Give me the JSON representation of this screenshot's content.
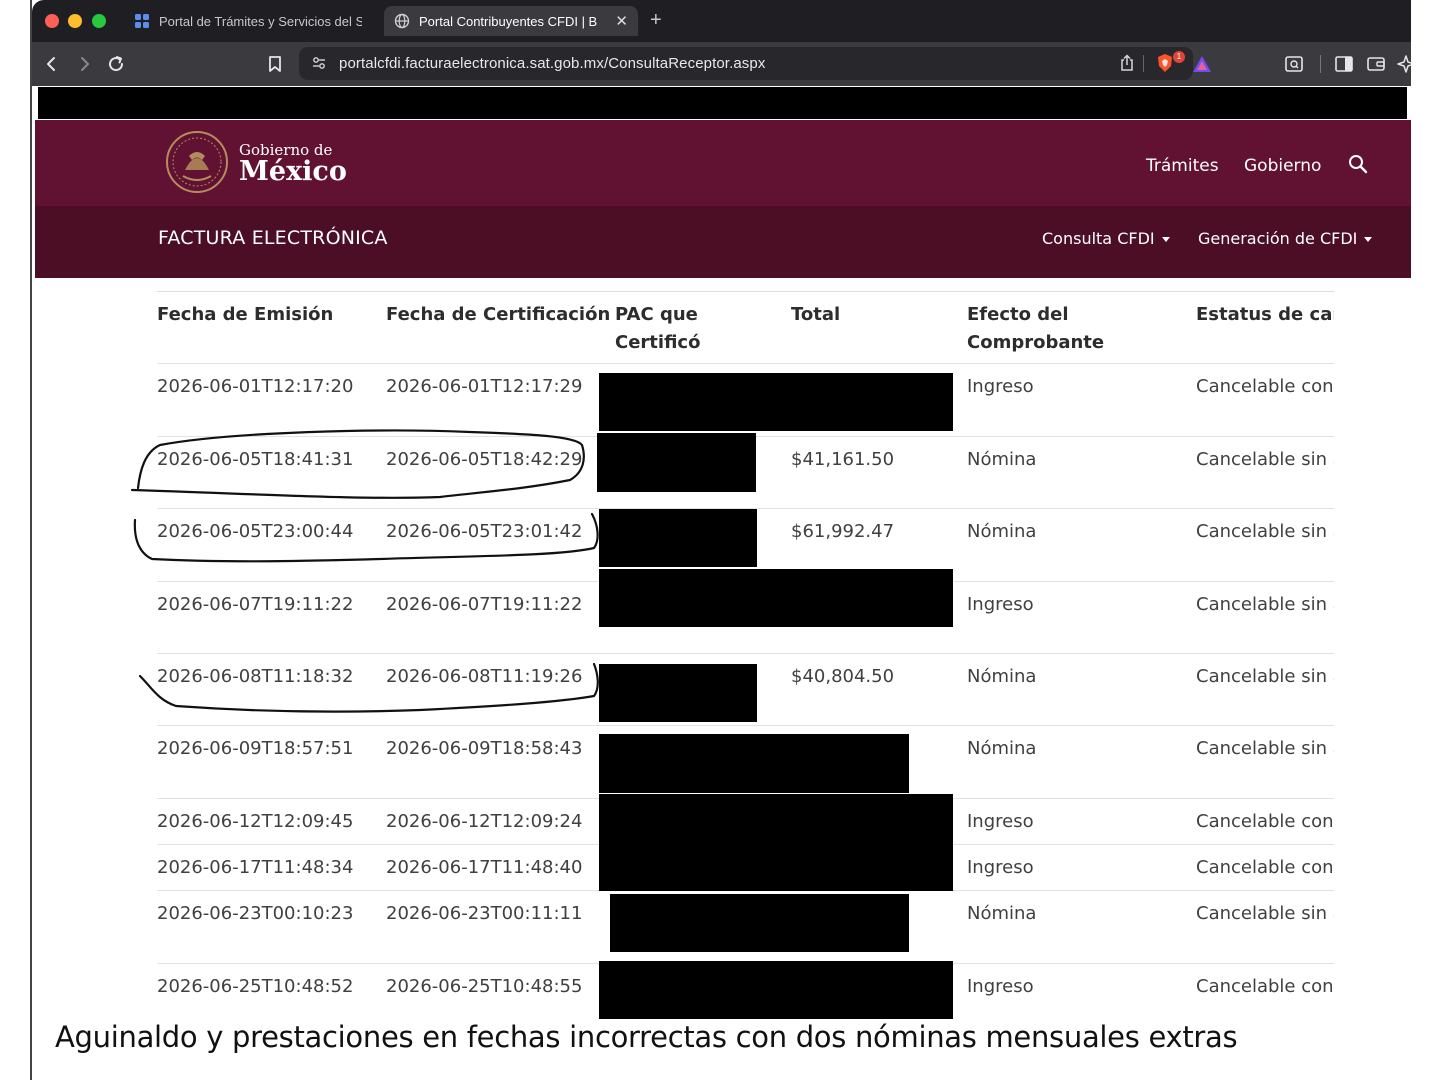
{
  "browser": {
    "tabs": [
      {
        "title": "Portal de Trámites y Servicios del S",
        "favicon": "grid-icon"
      },
      {
        "title": "Portal Contribuyentes CFDI | B",
        "favicon": "globe-icon",
        "active": true
      }
    ],
    "new_tab_label": "+",
    "close_tab_label": "✕",
    "url": "portalcfdi.facturaelectronica.sat.gob.mx/ConsultaReceptor.aspx",
    "notification_badge": "1"
  },
  "gob_header": {
    "logo_line1": "Gobierno de",
    "logo_line2": "México",
    "nav": {
      "tramites": "Trámites",
      "gobierno": "Gobierno"
    }
  },
  "sub_header": {
    "brand": "FACTURA ELECTRÓNICA",
    "menu": {
      "consulta": "Consulta CFDI",
      "generacion": "Generación de CFDI"
    }
  },
  "table": {
    "headers": {
      "fecha_emision": "Fecha de Emisión",
      "fecha_certificacion": "Fecha de Certificación",
      "pac_line1": "PAC que",
      "pac_line2": "Certificó",
      "total": "Total",
      "efecto_line1": "Efecto del",
      "efecto_line2": "Comprobante",
      "estatus": "Estatus de can"
    },
    "rows": [
      {
        "emision": "2026-06-01T12:17:20",
        "certificacion": "2026-06-01T12:17:29",
        "total": "",
        "efecto": "Ingreso",
        "estatus": "Cancelable con a"
      },
      {
        "emision": "2026-06-05T18:41:31",
        "certificacion": "2026-06-05T18:42:29",
        "total": "$41,161.50",
        "efecto": "Nómina",
        "estatus": "Cancelable sin a"
      },
      {
        "emision": "2026-06-05T23:00:44",
        "certificacion": "2026-06-05T23:01:42",
        "total": "$61,992.47",
        "efecto": "Nómina",
        "estatus": "Cancelable sin a"
      },
      {
        "emision": "2026-06-07T19:11:22",
        "certificacion": "2026-06-07T19:11:22",
        "total": "",
        "efecto": "Ingreso",
        "estatus": "Cancelable sin a"
      },
      {
        "emision": "2026-06-08T11:18:32",
        "certificacion": "2026-06-08T11:19:26",
        "total": "$40,804.50",
        "efecto": "Nómina",
        "estatus": "Cancelable sin a"
      },
      {
        "emision": "2026-06-09T18:57:51",
        "certificacion": "2026-06-09T18:58:43",
        "total": "",
        "efecto": "Nómina",
        "estatus": "Cancelable sin a"
      },
      {
        "emision": "2026-06-12T12:09:45",
        "certificacion": "2026-06-12T12:09:24",
        "total": "",
        "efecto": "Ingreso",
        "estatus": "Cancelable con a"
      },
      {
        "emision": "2026-06-17T11:48:34",
        "certificacion": "2026-06-17T11:48:40",
        "total": "",
        "efecto": "Ingreso",
        "estatus": "Cancelable con a"
      },
      {
        "emision": "2026-06-23T00:10:23",
        "certificacion": "2026-06-23T00:11:11",
        "total": "",
        "efecto": "Nómina",
        "estatus": "Cancelable sin a"
      },
      {
        "emision": "2026-06-25T10:48:52",
        "certificacion": "2026-06-25T10:48:55",
        "total": "",
        "efecto": "Ingreso",
        "estatus": "Cancelable con a"
      }
    ]
  },
  "caption": "Aguinaldo y prestaciones en fechas incorrectas con dos nóminas mensuales extras",
  "colors": {
    "gob_header": "#611232",
    "sub_header": "#4b0e25",
    "logo_gold": "#b38e5d",
    "browser_chrome": "#1f1f23",
    "annotation_ink": "#111111"
  }
}
